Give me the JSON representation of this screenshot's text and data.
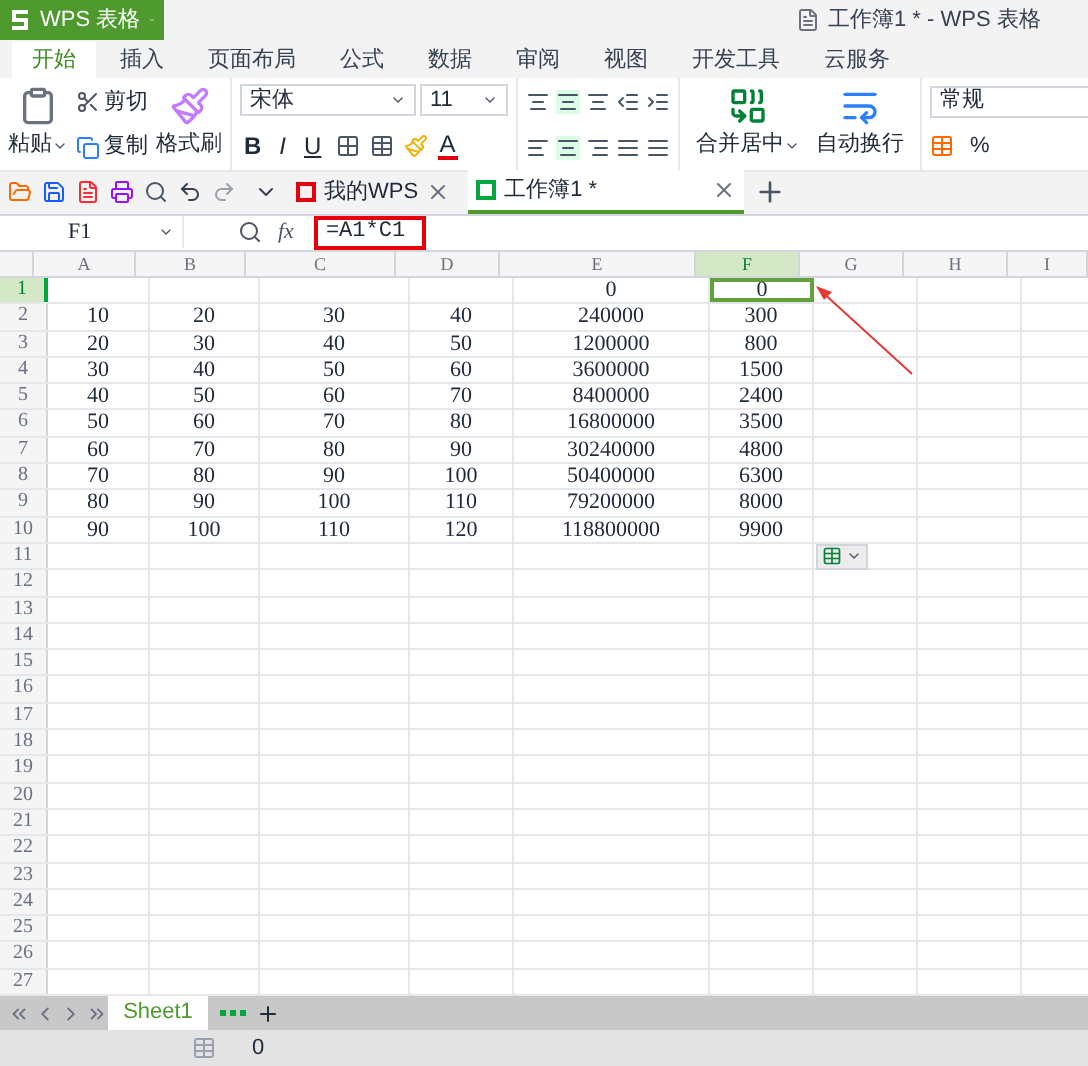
{
  "app_menu": {
    "label": "WPS 表格"
  },
  "window": {
    "title": "工作簿1 * - WPS 表格"
  },
  "tabs": [
    {
      "label": "开始",
      "selected": true
    },
    {
      "label": "插入",
      "selected": false
    },
    {
      "label": "页面布局",
      "selected": false
    },
    {
      "label": "公式",
      "selected": false
    },
    {
      "label": "数据",
      "selected": false
    },
    {
      "label": "审阅",
      "selected": false
    },
    {
      "label": "视图",
      "selected": false
    },
    {
      "label": "开发工具",
      "selected": false
    },
    {
      "label": "云服务",
      "selected": false
    }
  ],
  "ribbon": {
    "paste": "粘贴",
    "cut": "剪切",
    "copy": "复制",
    "format_painter": "格式刷",
    "font_name": "宋体",
    "font_size": "11",
    "bold": "B",
    "italic": "I",
    "underline": "U",
    "font_color": "A",
    "merge_center": "合并居中",
    "wrap_text": "自动换行",
    "number_format": "常规",
    "percent": "%"
  },
  "doc_tabs": [
    {
      "label": "我的WPS",
      "selected": false
    },
    {
      "label": "工作簿1 *",
      "selected": true
    }
  ],
  "formula_bar": {
    "name_box": "F1",
    "fx": "fx",
    "formula": "=A1*C1"
  },
  "columns": [
    {
      "label": "A",
      "selected": false
    },
    {
      "label": "B",
      "selected": false
    },
    {
      "label": "C",
      "selected": false
    },
    {
      "label": "D",
      "selected": false
    },
    {
      "label": "E",
      "selected": false
    },
    {
      "label": "F",
      "selected": true
    },
    {
      "label": "G",
      "selected": false
    },
    {
      "label": "H",
      "selected": false
    },
    {
      "label": "I",
      "selected": false
    }
  ],
  "rows": [
    {
      "number": "1",
      "selected": true,
      "cells": {
        "E": "0",
        "F": "0"
      }
    },
    {
      "number": "2",
      "selected": false,
      "cells": {
        "A": "10",
        "B": "20",
        "C": "30",
        "D": "40",
        "E": "240000",
        "F": "300"
      }
    },
    {
      "number": "3",
      "selected": false,
      "cells": {
        "A": "20",
        "B": "30",
        "C": "40",
        "D": "50",
        "E": "1200000",
        "F": "800"
      }
    },
    {
      "number": "4",
      "selected": false,
      "cells": {
        "A": "30",
        "B": "40",
        "C": "50",
        "D": "60",
        "E": "3600000",
        "F": "1500"
      }
    },
    {
      "number": "5",
      "selected": false,
      "cells": {
        "A": "40",
        "B": "50",
        "C": "60",
        "D": "70",
        "E": "8400000",
        "F": "2400"
      }
    },
    {
      "number": "6",
      "selected": false,
      "cells": {
        "A": "50",
        "B": "60",
        "C": "70",
        "D": "80",
        "E": "16800000",
        "F": "3500"
      }
    },
    {
      "number": "7",
      "selected": false,
      "cells": {
        "A": "60",
        "B": "70",
        "C": "80",
        "D": "90",
        "E": "30240000",
        "F": "4800"
      }
    },
    {
      "number": "8",
      "selected": false,
      "cells": {
        "A": "70",
        "B": "80",
        "C": "90",
        "D": "100",
        "E": "50400000",
        "F": "6300"
      }
    },
    {
      "number": "9",
      "selected": false,
      "cells": {
        "A": "80",
        "B": "90",
        "C": "100",
        "D": "110",
        "E": "79200000",
        "F": "8000"
      }
    },
    {
      "number": "10",
      "selected": false,
      "cells": {
        "A": "90",
        "B": "100",
        "C": "110",
        "D": "120",
        "E": "118800000",
        "F": "9900"
      }
    },
    {
      "number": "11",
      "selected": false
    },
    {
      "number": "12",
      "selected": false
    },
    {
      "number": "13",
      "selected": false
    },
    {
      "number": "14",
      "selected": false
    },
    {
      "number": "15",
      "selected": false
    },
    {
      "number": "16",
      "selected": false
    },
    {
      "number": "17",
      "selected": false
    },
    {
      "number": "18",
      "selected": false
    },
    {
      "number": "19",
      "selected": false
    },
    {
      "number": "20",
      "selected": false
    },
    {
      "number": "21",
      "selected": false
    },
    {
      "number": "22",
      "selected": false
    },
    {
      "number": "23",
      "selected": false
    },
    {
      "number": "24",
      "selected": false
    },
    {
      "number": "25",
      "selected": false
    },
    {
      "number": "26",
      "selected": false
    },
    {
      "number": "27",
      "selected": false
    }
  ],
  "sheet_tabs": [
    {
      "label": "Sheet1",
      "selected": true
    }
  ],
  "status_bar": {
    "value": "0"
  }
}
